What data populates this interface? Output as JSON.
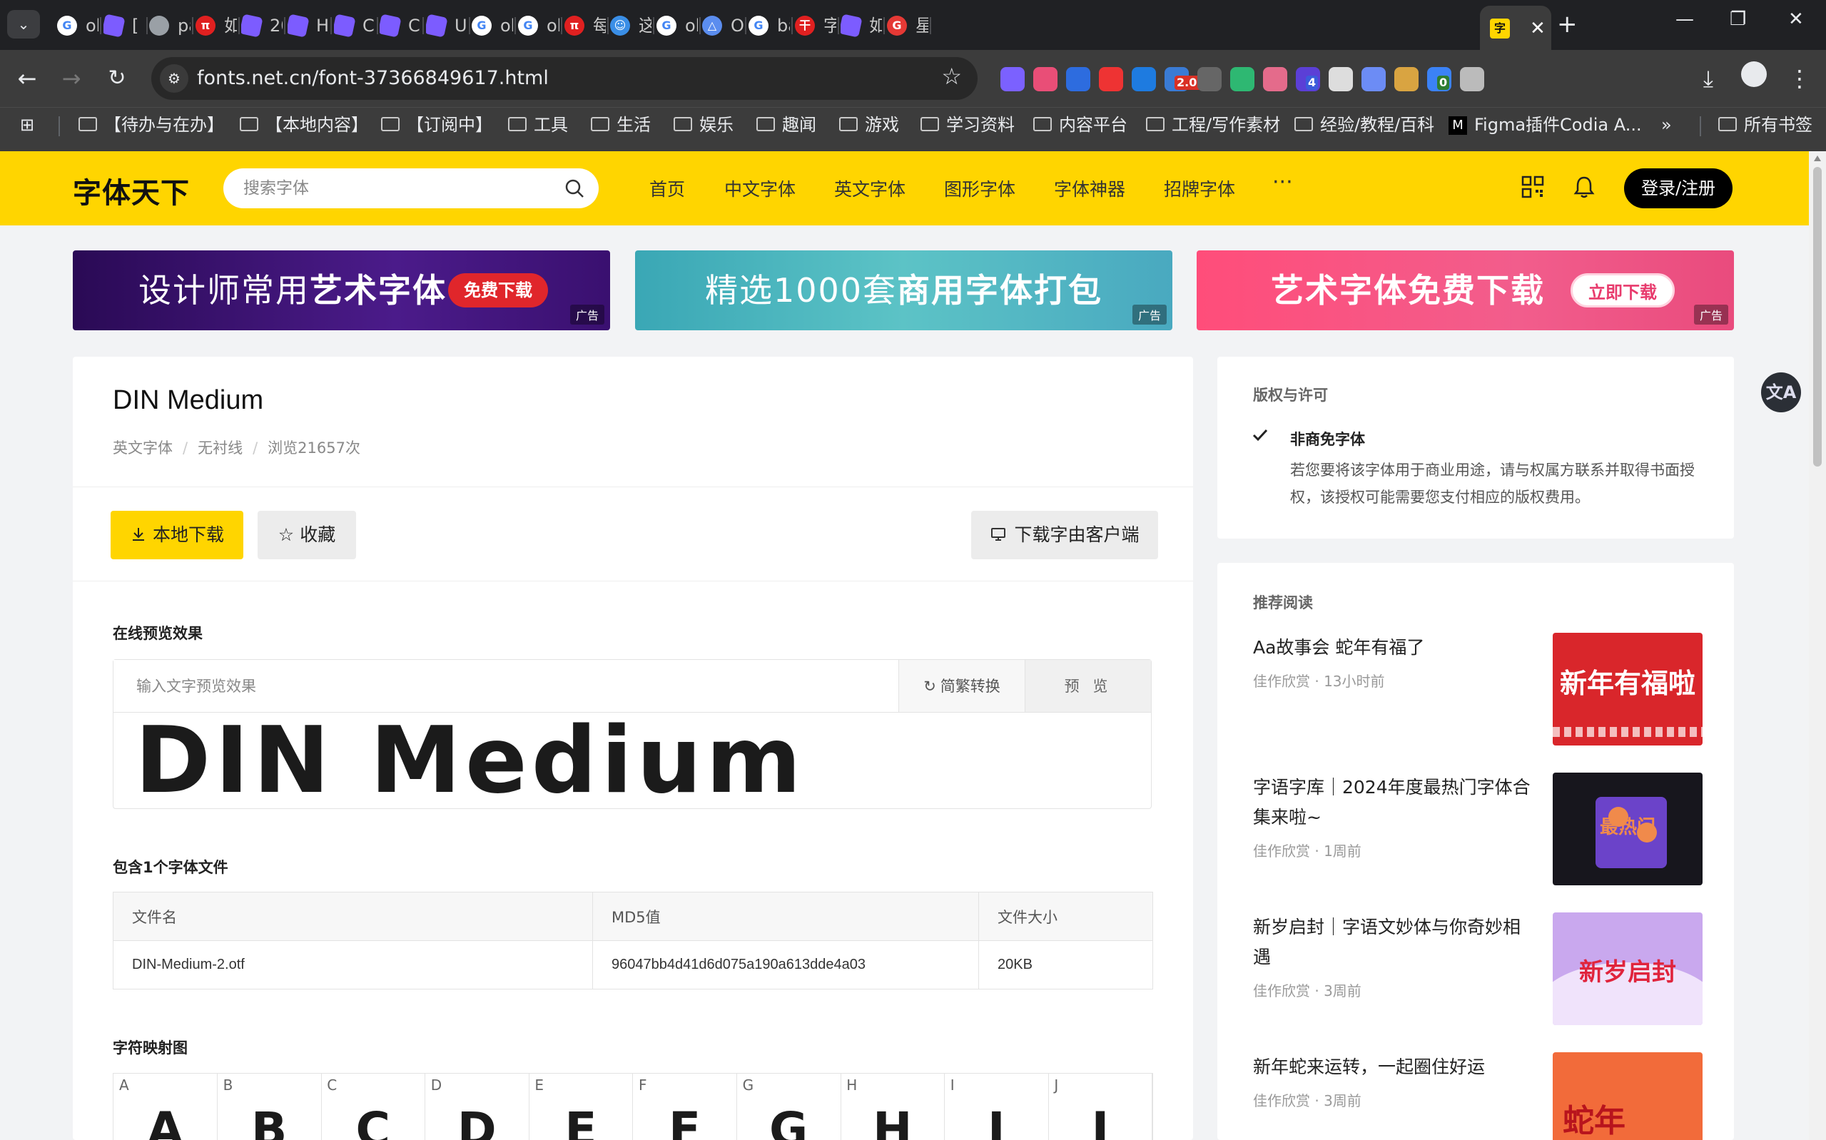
{
  "browser": {
    "tabs": [
      {
        "title": "ob",
        "fav": "google",
        "favColor": "#ffffff",
        "glyph": "G"
      },
      {
        "title": "[",
        "fav": "obsidian",
        "favColor": "#7c5cff",
        "glyph": ""
      },
      {
        "title": "pa",
        "fav": "globe",
        "favColor": "#9aa0a6",
        "glyph": ""
      },
      {
        "title": "如",
        "fav": "red",
        "favColor": "#e02020",
        "glyph": "π"
      },
      {
        "title": "20",
        "fav": "obsidian",
        "favColor": "#7c5cff",
        "glyph": ""
      },
      {
        "title": "Ho",
        "fav": "obsidian",
        "favColor": "#7c5cff",
        "glyph": ""
      },
      {
        "title": "Ch",
        "fav": "obsidian",
        "favColor": "#7c5cff",
        "glyph": ""
      },
      {
        "title": "CS",
        "fav": "obsidian",
        "favColor": "#7c5cff",
        "glyph": ""
      },
      {
        "title": "Us",
        "fav": "obsidian",
        "favColor": "#7c5cff",
        "glyph": ""
      },
      {
        "title": "ob",
        "fav": "google",
        "favColor": "#ffffff",
        "glyph": "G"
      },
      {
        "title": "ob",
        "fav": "google",
        "favColor": "#ffffff",
        "glyph": "G"
      },
      {
        "title": "每",
        "fav": "red",
        "favColor": "#e02020",
        "glyph": "π"
      },
      {
        "title": "这",
        "fav": "bot",
        "favColor": "#3a8ee6",
        "glyph": "☺"
      },
      {
        "title": "ol",
        "fav": "google",
        "favColor": "#ffffff",
        "glyph": "G"
      },
      {
        "title": "Or",
        "fav": "triangle",
        "favColor": "#5b8def",
        "glyph": "△"
      },
      {
        "title": "ba",
        "fav": "google",
        "favColor": "#ffffff",
        "glyph": "G"
      },
      {
        "title": "字",
        "fav": "red-logo",
        "favColor": "#e02020",
        "glyph": "干"
      },
      {
        "title": "如",
        "fav": "obsidian",
        "favColor": "#7c5cff",
        "glyph": ""
      },
      {
        "title": "星",
        "fav": "g-red",
        "favColor": "#e53935",
        "glyph": "G"
      }
    ],
    "active_tab": {
      "glyph": "字",
      "close": "✕"
    },
    "new_tab": "+",
    "window": {
      "minimize": "—",
      "restore": "❐",
      "close": "✕"
    },
    "url": "fonts.net.cn/font-37366849617.html",
    "extensions": [
      {
        "name": "ext-purple",
        "color": "#7b61ff"
      },
      {
        "name": "ext-colorwheel",
        "color": "#e94e77"
      },
      {
        "name": "ext-z",
        "color": "#2d6cdf"
      },
      {
        "name": "ext-red-hand",
        "color": "#e33"
      },
      {
        "name": "ext-blue-s",
        "color": "#1e7be0"
      },
      {
        "name": "ext-speed",
        "color": "#3a7bd5",
        "badge": "2.00",
        "badgeColor": "#d93025"
      },
      {
        "name": "ext-goggles",
        "color": "#666"
      },
      {
        "name": "ext-green-m",
        "color": "#2eb872"
      },
      {
        "name": "ext-cat",
        "color": "#e46b8b"
      },
      {
        "name": "ext-cube",
        "color": "#5b3fd6",
        "badge": "4",
        "badgeColor": "#3b5bdb"
      },
      {
        "name": "ext-mountain",
        "color": "#ddd"
      },
      {
        "name": "ext-blue-square",
        "color": "#6c8cf5"
      },
      {
        "name": "ext-earth",
        "color": "#d9a441"
      },
      {
        "name": "ext-blue-globe",
        "color": "#3b82f6",
        "badge": "0",
        "badgeColor": "#2e7d32"
      },
      {
        "name": "ext-puzzle",
        "color": "#bbb"
      }
    ],
    "bookmarks": [
      "【待办与在办】",
      "【本地内容】",
      "【订阅中】",
      "工具",
      "生活",
      "娱乐",
      "趣闻",
      "游戏",
      "学习资料",
      "内容平台",
      "工程/写作素材",
      "经验/教程/百科"
    ],
    "bookmark_figma": "Figma插件Codia A...",
    "bookmark_more": "»",
    "bookmark_all": "所有书签"
  },
  "site": {
    "logo": "字体天下",
    "search_placeholder": "搜索字体",
    "nav": [
      "首页",
      "中文字体",
      "英文字体",
      "图形字体",
      "字体神器",
      "招牌字体",
      "···"
    ],
    "login": "登录/注册",
    "accent": "#ffd500"
  },
  "banners": [
    {
      "pre": "设计师常用",
      "hl": "艺术字体",
      "btn": "免费下载",
      "ad": "广告"
    },
    {
      "pre": "精选1000套",
      "hl": "商用字体打包",
      "btn": "",
      "ad": "广告"
    },
    {
      "pre": "艺术字体免费下载",
      "hl": "",
      "btn": "立即下载",
      "ad": "广告"
    }
  ],
  "font": {
    "name": "DIN Medium",
    "category": "英文字体",
    "style": "无衬线",
    "views": "浏览21657次",
    "download": "本地下载",
    "favorite": "收藏",
    "client": "下载字由客户端"
  },
  "preview": {
    "section": "在线预览效果",
    "placeholder": "输入文字预览效果",
    "convert": "简繁转换",
    "preview_btn": "预 览",
    "sample": "DIN Medium"
  },
  "files": {
    "section": "包含1个字体文件",
    "headers": [
      "文件名",
      "MD5值",
      "文件大小"
    ],
    "rows": [
      [
        "DIN-Medium-2.otf",
        "96047bb4d41d6d075a190a613dde4a03",
        "20KB"
      ]
    ]
  },
  "charmap": {
    "section": "字符映射图",
    "chars": [
      "A",
      "B",
      "C",
      "D",
      "E",
      "F",
      "G",
      "H",
      "I",
      "J"
    ]
  },
  "license": {
    "section": "版权与许可",
    "type": "非商免字体",
    "desc": "若您要将该字体用于商业用途，请与权属方联系并取得书面授权，该授权可能需要您支付相应的版权费用。"
  },
  "reading": {
    "section": "推荐阅读",
    "articles": [
      {
        "title": "Aa故事会 蛇年有福了",
        "meta": "佳作欣赏 · 13小时前",
        "thumb_text": "新年有福啦"
      },
      {
        "title": "字语字库｜2024年度最热门字体合集来啦~",
        "meta": "佳作欣赏 · 1周前",
        "thumb_text": "最热门"
      },
      {
        "title": "新岁启封｜字语文妙体与你奇妙相遇",
        "meta": "佳作欣赏 · 3周前",
        "thumb_text": "新岁启封"
      },
      {
        "title": "新年蛇来运转，一起圈住好运",
        "meta": "佳作欣赏 · 3周前",
        "thumb_text": "蛇年"
      }
    ]
  },
  "fab": "文A"
}
